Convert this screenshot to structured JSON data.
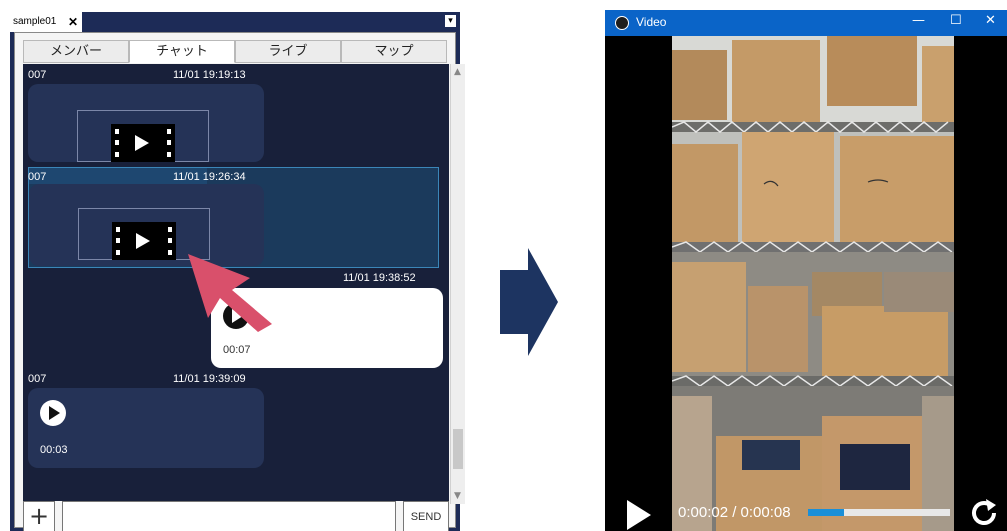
{
  "chat_window": {
    "tab_label": "sample01",
    "tab_close": "✕",
    "menu_icon": "▾",
    "nav_tabs": [
      "メンバー",
      "チャット",
      "ライブ",
      "マップ"
    ],
    "active_tab": "チャット",
    "messages": [
      {
        "sender": "007",
        "time": "11/01 19:19:13",
        "type": "video"
      },
      {
        "sender": "007",
        "time": "11/01 19:26:34",
        "type": "video",
        "selected": true
      },
      {
        "sender": "",
        "time": "11/01 19:38:52",
        "type": "audio",
        "duration": "00:07",
        "own": true
      },
      {
        "sender": "007",
        "time": "11/01 19:39:09",
        "type": "audio",
        "duration": "00:03"
      }
    ],
    "input": {
      "add_label": "+",
      "placeholder": "",
      "send_label": "SEND"
    },
    "colors": {
      "background": "#1d2b57",
      "bubble": "#253357",
      "selected": "#1b3a5c",
      "cursor": "#d9506b"
    }
  },
  "video_window": {
    "title": "Video",
    "controls": {
      "minimize": "—",
      "maximize": "☐",
      "close": "✕"
    },
    "timecode": "0:00:02 / 0:00:08",
    "progress": 0.25,
    "colors": {
      "titlebar": "#0a64c8",
      "progress": "#1a8fd8"
    }
  },
  "icons": [
    "close-icon",
    "menu-icon",
    "film-play-icon",
    "play-icon",
    "plus-icon",
    "cursor-arrow-icon",
    "flow-arrow-icon",
    "app-icon",
    "replay-icon"
  ]
}
